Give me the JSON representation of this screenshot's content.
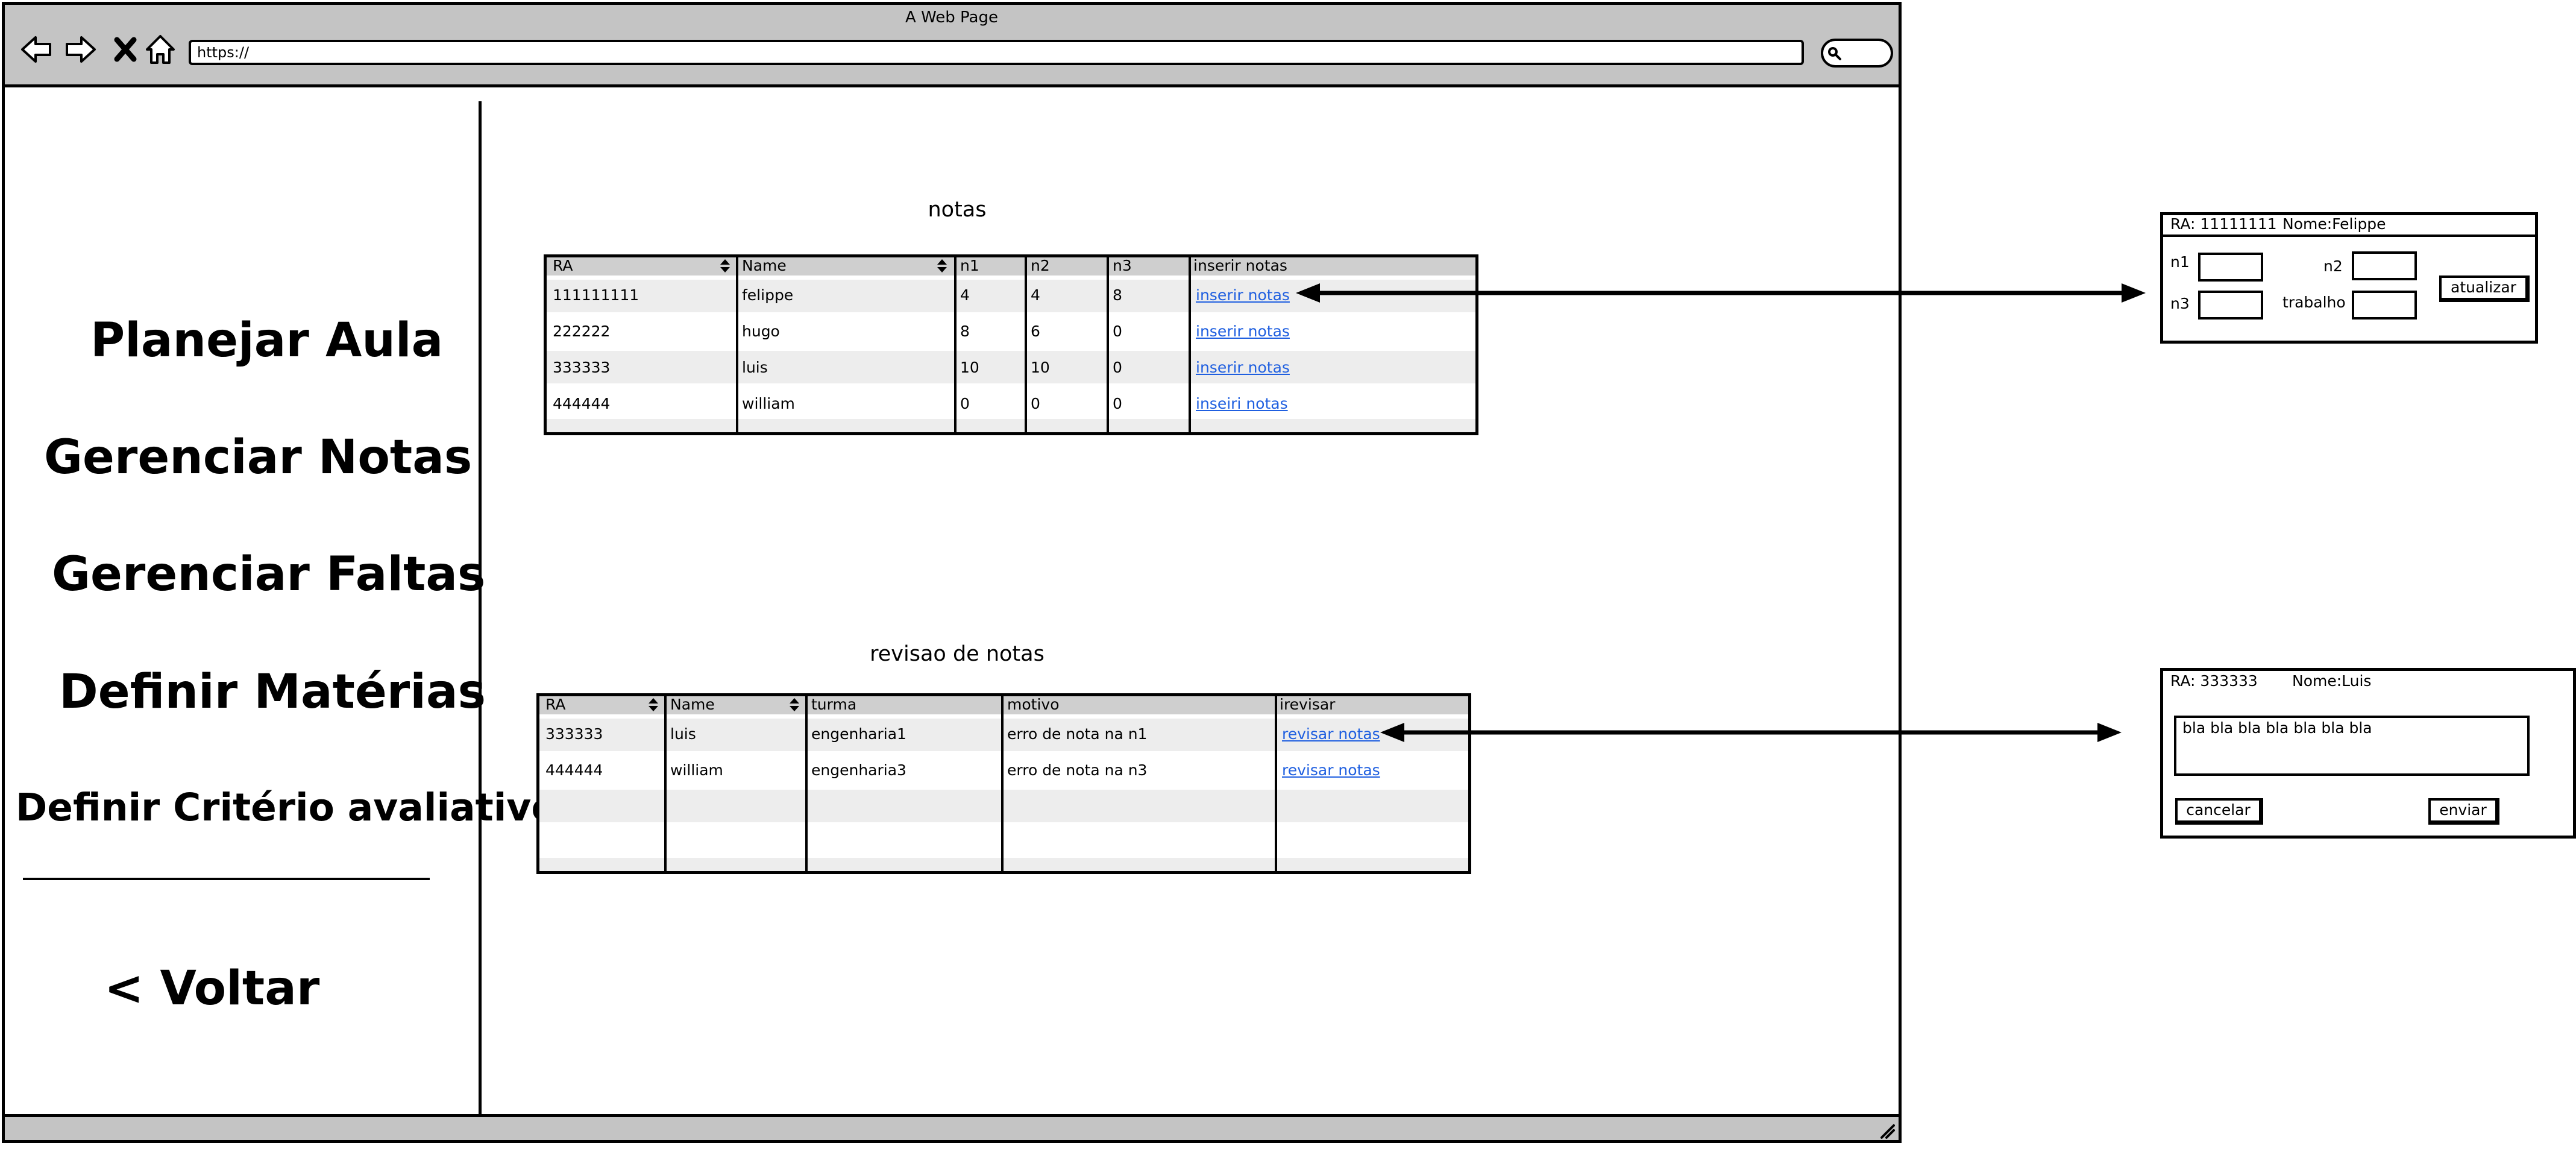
{
  "browser": {
    "title": "A Web Page",
    "url": "https://"
  },
  "sidebar": {
    "items": [
      {
        "label": "Planejar Aula"
      },
      {
        "label": "Gerenciar Notas"
      },
      {
        "label": "Gerenciar Faltas"
      },
      {
        "label": "Definir Matérias"
      },
      {
        "label": "Definir Critério avaliativo"
      }
    ],
    "back_label": "< Voltar"
  },
  "notas": {
    "title": "notas",
    "columns": [
      "RA",
      "Name",
      "n1",
      "n2",
      "n3",
      "inserir notas"
    ],
    "rows": [
      {
        "ra": "111111111",
        "name": "felippe",
        "n1": "4",
        "n2": "4",
        "n3": "8",
        "action": "inserir notas"
      },
      {
        "ra": "222222",
        "name": "hugo",
        "n1": "8",
        "n2": "6",
        "n3": "0",
        "action": "inserir notas"
      },
      {
        "ra": "333333",
        "name": "luis",
        "n1": "10",
        "n2": "10",
        "n3": "0",
        "action": "inserir notas"
      },
      {
        "ra": "444444",
        "name": "william",
        "n1": "0",
        "n2": "0",
        "n3": "0",
        "action": "inseiri notas"
      }
    ]
  },
  "revisao": {
    "title": "revisao de notas",
    "columns": [
      "RA",
      "Name",
      "turma",
      "motivo",
      "irevisar"
    ],
    "rows": [
      {
        "ra": "333333",
        "name": "luis",
        "turma": "engenharia1",
        "motivo": "erro de nota na n1",
        "action": "revisar notas"
      },
      {
        "ra": "444444",
        "name": "william",
        "turma": "engenharia3",
        "motivo": "erro de nota na n3",
        "action": "revisar notas"
      }
    ]
  },
  "dialog_notas": {
    "ra": "RA:  11111111",
    "nome": "Nome:Felippe",
    "n1_label": "n1",
    "n2_label": "n2",
    "n3_label": "n3",
    "trabalho_label": "trabalho",
    "submit_label": "atualizar"
  },
  "dialog_revisao": {
    "ra": "RA:  333333",
    "nome": "Nome:Luis",
    "message": "bla bla bla bla bla bla bla",
    "cancel_label": "cancelar",
    "send_label": "enviar"
  },
  "icons": [
    "back-arrow-icon",
    "forward-arrow-icon",
    "close-icon",
    "home-icon",
    "search-icon",
    "sort-icon",
    "resize-grip-icon",
    "double-arrow-connector"
  ]
}
